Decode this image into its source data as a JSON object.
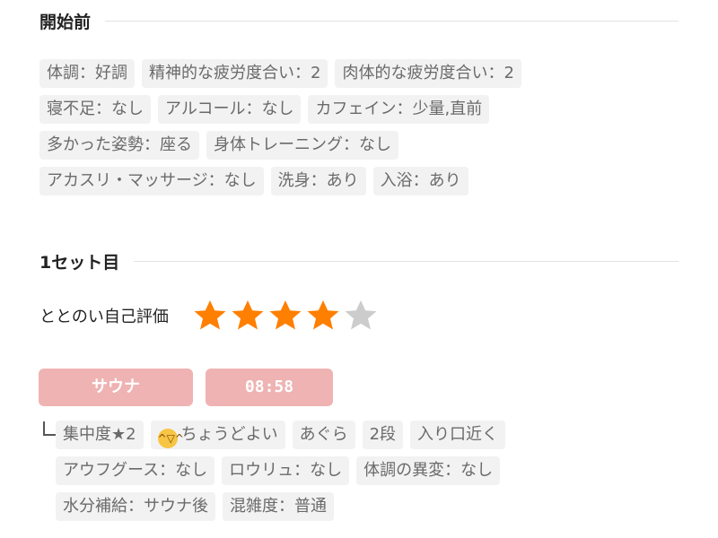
{
  "before": {
    "title": "開始前",
    "rows": [
      [
        "体調：好調",
        "精神的な疲労度合い：2",
        "肉体的な疲労度合い：2"
      ],
      [
        "寝不足：なし",
        "アルコール：なし",
        "カフェイン：少量,直前"
      ],
      [
        "多かった姿勢：座る",
        "身体トレーニング：なし"
      ],
      [
        "アカスリ・マッサージ：なし",
        "洗身：あり",
        "入浴：あり"
      ]
    ]
  },
  "set1": {
    "title": "1セット目",
    "eval_label": "ととのい自己評価",
    "rating": 4,
    "rating_max": 5,
    "star_color": "#ff7f00",
    "star_empty_color": "#cccccc",
    "sauna_label": "サウナ",
    "time": "08:58",
    "pill_color": "#eeb3b2",
    "details": [
      [
        "集中度★2",
        "ちょうどよい",
        "あぐら",
        "2段",
        "入り口近く"
      ],
      [
        "アウフグース：なし",
        "ロウリュ：なし",
        "体調の異変：なし"
      ],
      [
        "水分補給：サウナ後",
        "混雑度：普通"
      ]
    ]
  }
}
